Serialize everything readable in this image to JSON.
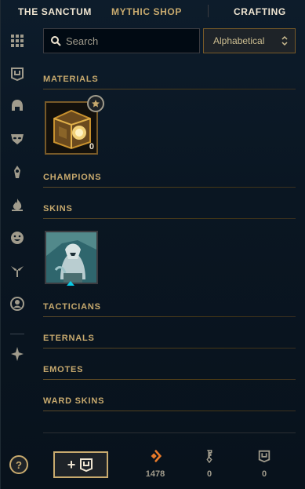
{
  "nav": {
    "tabs": [
      {
        "label": "THE SANCTUM"
      },
      {
        "label": "MYTHIC SHOP"
      },
      {
        "label": "CRAFTING"
      }
    ]
  },
  "search": {
    "placeholder": "Search",
    "value": ""
  },
  "sort": {
    "selected": "Alphabetical"
  },
  "sidebar": {
    "icons": [
      "grid-icon",
      "chest-icon",
      "helmet-icon",
      "mask-icon",
      "ward-icon",
      "flame-icon",
      "emote-icon",
      "winged-icon",
      "profile-icon",
      "crafting-icon"
    ]
  },
  "sections": {
    "materials": "MATERIALS",
    "champions": "CHAMPIONS",
    "skins": "SKINS",
    "tacticians": "TACTICIANS",
    "eternals": "ETERNALS",
    "emotes": "EMOTES",
    "ward_skins": "WARD SKINS"
  },
  "materials": {
    "items": [
      {
        "name": "Hextech Chest",
        "count": "0"
      }
    ]
  },
  "help": {
    "label": "?"
  },
  "bottom": {
    "add_plus": "+",
    "currencies": [
      {
        "name": "orange-essence",
        "value": "1478"
      },
      {
        "name": "key",
        "value": "0"
      },
      {
        "name": "chest",
        "value": "0"
      }
    ]
  },
  "colors": {
    "gold": "#c8aa6e",
    "orange_essence": "#e87a2a",
    "background": "#0a1723"
  }
}
